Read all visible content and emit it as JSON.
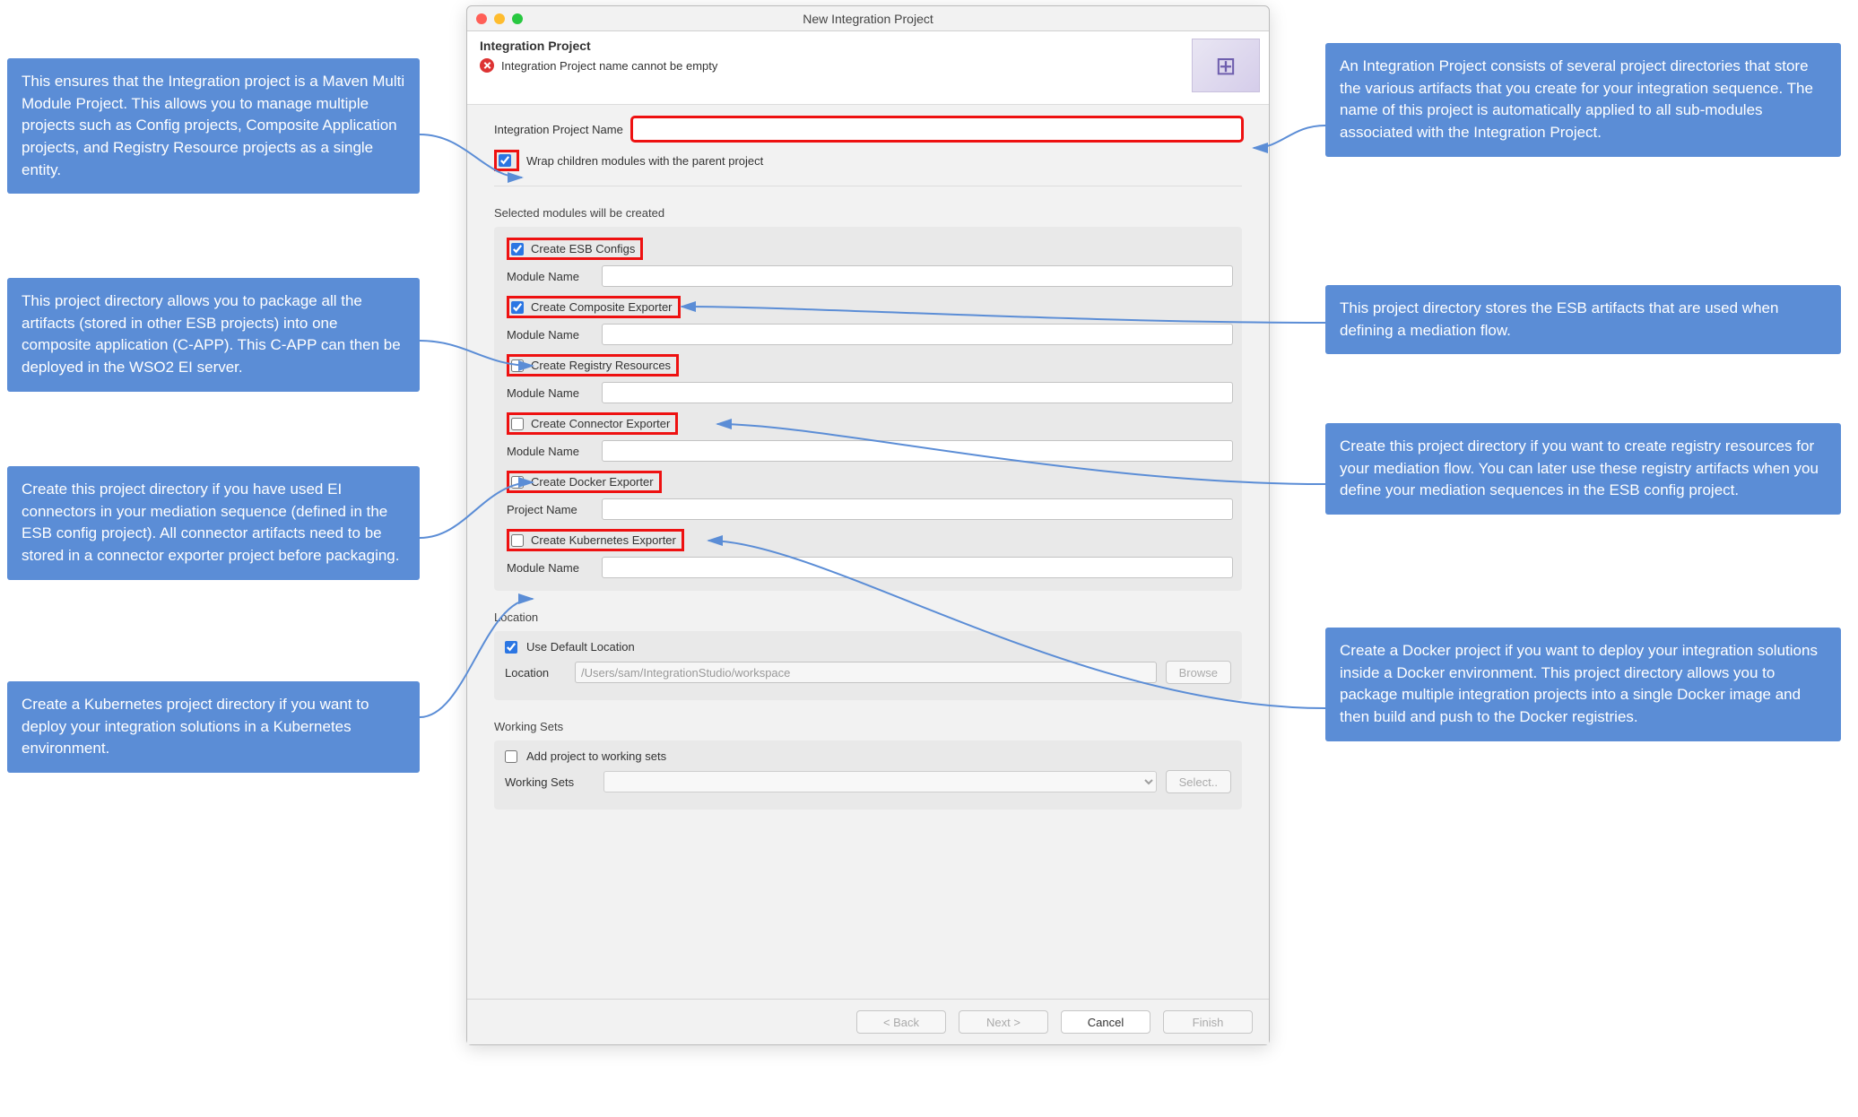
{
  "window": {
    "title": "New Integration Project"
  },
  "header": {
    "title": "Integration Project",
    "error": "Integration Project name cannot be empty"
  },
  "form": {
    "name_label": "Integration Project Name",
    "name_value": "",
    "wrap_label": "Wrap children modules with the parent project",
    "wrap_checked": true
  },
  "modules": {
    "heading": "Selected modules will be created",
    "items": [
      {
        "label": "Create ESB Configs",
        "checked": true,
        "field_label": "Module Name",
        "field_value": ""
      },
      {
        "label": "Create Composite Exporter",
        "checked": true,
        "field_label": "Module Name",
        "field_value": ""
      },
      {
        "label": "Create Registry Resources",
        "checked": false,
        "field_label": "Module Name",
        "field_value": ""
      },
      {
        "label": "Create Connector Exporter",
        "checked": false,
        "field_label": "Module Name",
        "field_value": ""
      },
      {
        "label": "Create Docker Exporter",
        "checked": false,
        "field_label": "Project Name",
        "field_value": ""
      },
      {
        "label": "Create Kubernetes Exporter",
        "checked": false,
        "field_label": "Module Name",
        "field_value": ""
      }
    ]
  },
  "location": {
    "heading": "Location",
    "use_default_label": "Use Default Location",
    "use_default_checked": true,
    "location_label": "Location",
    "location_value": "/Users/sam/IntegrationStudio/workspace",
    "browse": "Browse"
  },
  "working_sets": {
    "heading": "Working Sets",
    "add_label": "Add project to working sets",
    "add_checked": false,
    "ws_label": "Working Sets",
    "select": "Select.."
  },
  "footer": {
    "back": "< Back",
    "next": "Next >",
    "cancel": "Cancel",
    "finish": "Finish"
  },
  "callouts": {
    "left1": "This ensures that the Integration project is a Maven Multi Module Project. This allows you to manage multiple projects such as Config projects, Composite Application projects, and Registry Resource projects as a single entity.",
    "left2": "This project directory allows you to package all the artifacts (stored in other ESB projects) into one composite application (C-APP). This C-APP can then be deployed in the WSO2 EI server.",
    "left3": "Create this project directory if you have used EI connectors in your mediation sequence (defined in the ESB config project). All connector artifacts need to be stored in a connector exporter project before packaging.",
    "left4": "Create a Kubernetes project directory if you want to deploy your integration solutions in a Kubernetes environment.",
    "right1": "An Integration Project consists of several project directories that store the various artifacts that you create for your integration sequence. The name of this project is automatically applied to all sub-modules associated with the Integration Project.",
    "right2": "This project directory stores the ESB artifacts that are used when defining a mediation flow.",
    "right3": "Create this project directory if you want to create registry resources for your mediation flow. You can later use these registry artifacts when you define your mediation sequences in the ESB config project.",
    "right4": "Create a Docker project if you want to deploy your integration solutions inside a Docker environment. This project directory allows you to package multiple integration projects into a single Docker image and then build and push to the Docker registries."
  }
}
